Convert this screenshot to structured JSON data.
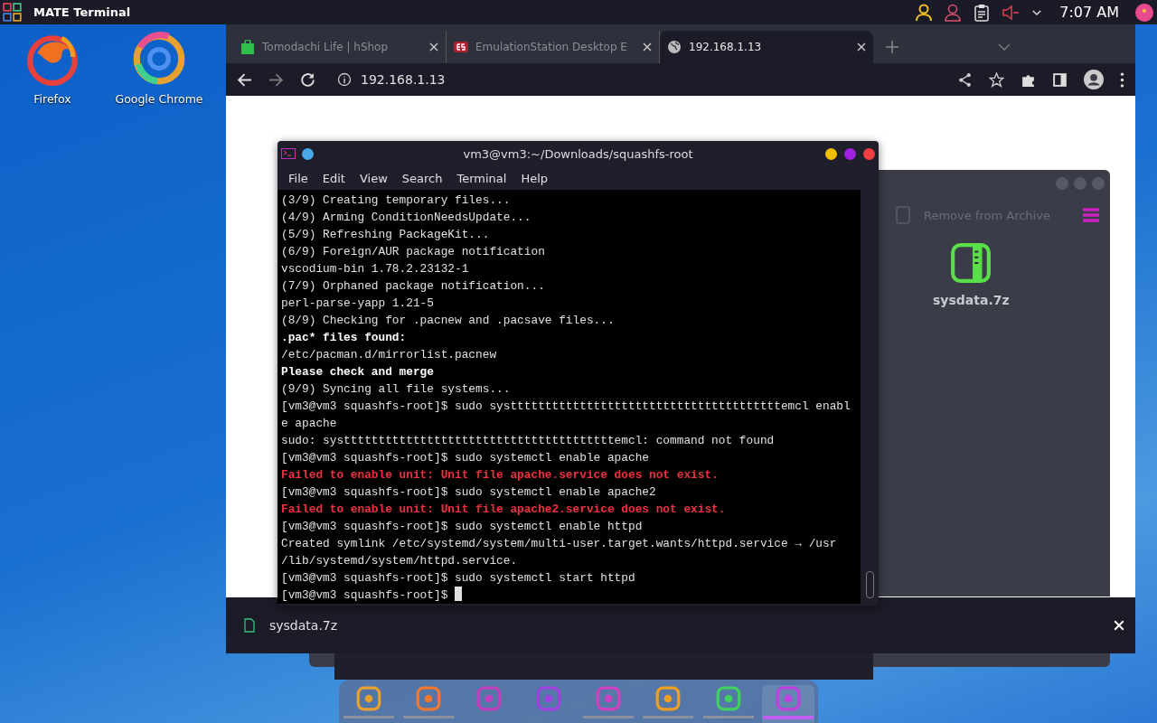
{
  "top_panel": {
    "app_title": "MATE Terminal",
    "clock": "7:07 AM"
  },
  "desktop_icons": [
    {
      "label": "Firefox",
      "kind": "firefox"
    },
    {
      "label": "Google Chrome",
      "kind": "chrome"
    }
  ],
  "browser": {
    "tabs": [
      {
        "label": "Tomodachi Life | hShop",
        "kind": "shop",
        "selected": false
      },
      {
        "label": "EmulationStation Desktop E",
        "kind": "es",
        "selected": false
      },
      {
        "label": "192.168.1.13",
        "kind": "globe",
        "selected": true
      }
    ],
    "address": "192.168.1.13",
    "download": {
      "file": "sysdata.7z"
    }
  },
  "archive": {
    "action": "Remove from Archive",
    "file": "sysdata.7z"
  },
  "terminal": {
    "title": "vm3@vm3:~/Downloads/squashfs-root",
    "menu": [
      "File",
      "Edit",
      "View",
      "Search",
      "Terminal",
      "Help"
    ],
    "lines": [
      {
        "text": "(3/9) Creating temporary files...",
        "kind": "normal"
      },
      {
        "text": "(4/9) Arming ConditionNeedsUpdate...",
        "kind": "normal"
      },
      {
        "text": "(5/9) Refreshing PackageKit...",
        "kind": "normal"
      },
      {
        "text": "(6/9) Foreign/AUR package notification",
        "kind": "normal"
      },
      {
        "text": "vscodium-bin 1.78.2.23132-1",
        "kind": "normal"
      },
      {
        "text": "(7/9) Orphaned package notification...",
        "kind": "normal"
      },
      {
        "text": "perl-parse-yapp 1.21-5",
        "kind": "normal"
      },
      {
        "text": "(8/9) Checking for .pacnew and .pacsave files...",
        "kind": "normal"
      },
      {
        "text": ".pac* files found:",
        "kind": "bold"
      },
      {
        "text": "/etc/pacman.d/mirrorlist.pacnew",
        "kind": "normal"
      },
      {
        "text": "Please check and merge",
        "kind": "bold"
      },
      {
        "text": "(9/9) Syncing all file systems...",
        "kind": "normal"
      },
      {
        "text": "[vm3@vm3 squashfs-root]$ sudo systttttttttttttttttttttttttttttttttttttttemcl enabl",
        "kind": "normal"
      },
      {
        "text": "e apache",
        "kind": "normal"
      },
      {
        "text": "sudo: systttttttttttttttttttttttttttttttttttttttemcl: command not found",
        "kind": "normal"
      },
      {
        "text": "[vm3@vm3 squashfs-root]$ sudo systemctl enable apache",
        "kind": "normal"
      },
      {
        "text": "Failed to enable unit: Unit file apache.service does not exist.",
        "kind": "error"
      },
      {
        "text": "[vm3@vm3 squashfs-root]$ sudo systemctl enable apache2",
        "kind": "normal"
      },
      {
        "text": "Failed to enable unit: Unit file apache2.service does not exist.",
        "kind": "error"
      },
      {
        "text": "[vm3@vm3 squashfs-root]$ sudo systemctl enable httpd",
        "kind": "normal"
      },
      {
        "text": "Created symlink /etc/systemd/system/multi-user.target.wants/httpd.service → /usr",
        "kind": "normal"
      },
      {
        "text": "/lib/systemd/system/httpd.service.",
        "kind": "normal"
      },
      {
        "text": "[vm3@vm3 squashfs-root]$ sudo systemctl start httpd",
        "kind": "normal"
      },
      {
        "text": "[vm3@vm3 squashfs-root]$ ",
        "kind": "prompt"
      }
    ]
  },
  "dock": [
    {
      "kind": "chrome",
      "running": true,
      "selected": false
    },
    {
      "kind": "files",
      "running": true,
      "selected": false
    },
    {
      "kind": "monitor",
      "running": false,
      "selected": false
    },
    {
      "kind": "settings",
      "running": false,
      "selected": false
    },
    {
      "kind": "editor",
      "running": true,
      "selected": false
    },
    {
      "kind": "bookmark",
      "running": true,
      "selected": false
    },
    {
      "kind": "archive",
      "running": true,
      "selected": false
    },
    {
      "kind": "terminal",
      "running": true,
      "selected": true
    }
  ]
}
